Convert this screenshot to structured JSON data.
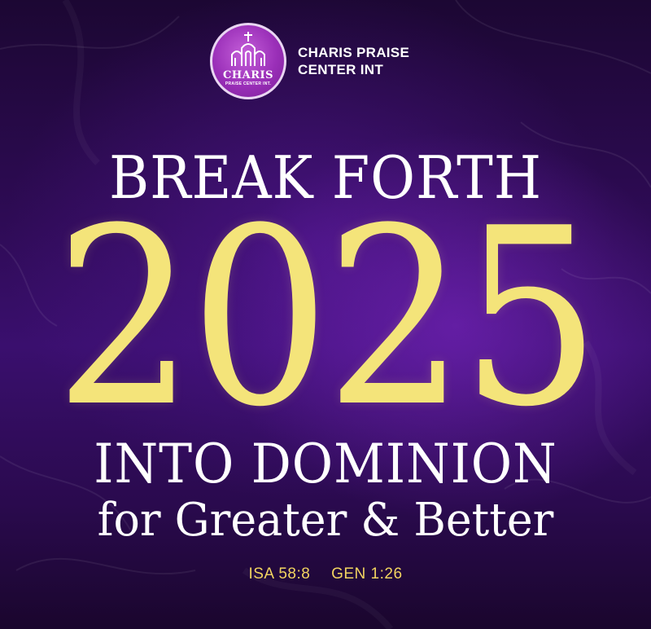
{
  "brand": {
    "name_line1": "CHARIS PRAISE",
    "name_line2": "CENTER INT",
    "logo_word": "CHARIS",
    "logo_subtext": "PRAISE CENTER INT."
  },
  "headline": {
    "line1": "BREAK FORTH",
    "year": "2025",
    "line3": "INTO DOMINION",
    "line4": "for Greater & Better"
  },
  "references": [
    "ISA 58:8",
    "GEN 1:26"
  ],
  "colors": {
    "background": "#2e0b55",
    "accent_gold": "#f4e47a",
    "reference_gold": "#f2d460",
    "logo_purple": "#9a2fb8",
    "text": "#ffffff"
  },
  "icons": [
    "church-logo-icon"
  ]
}
